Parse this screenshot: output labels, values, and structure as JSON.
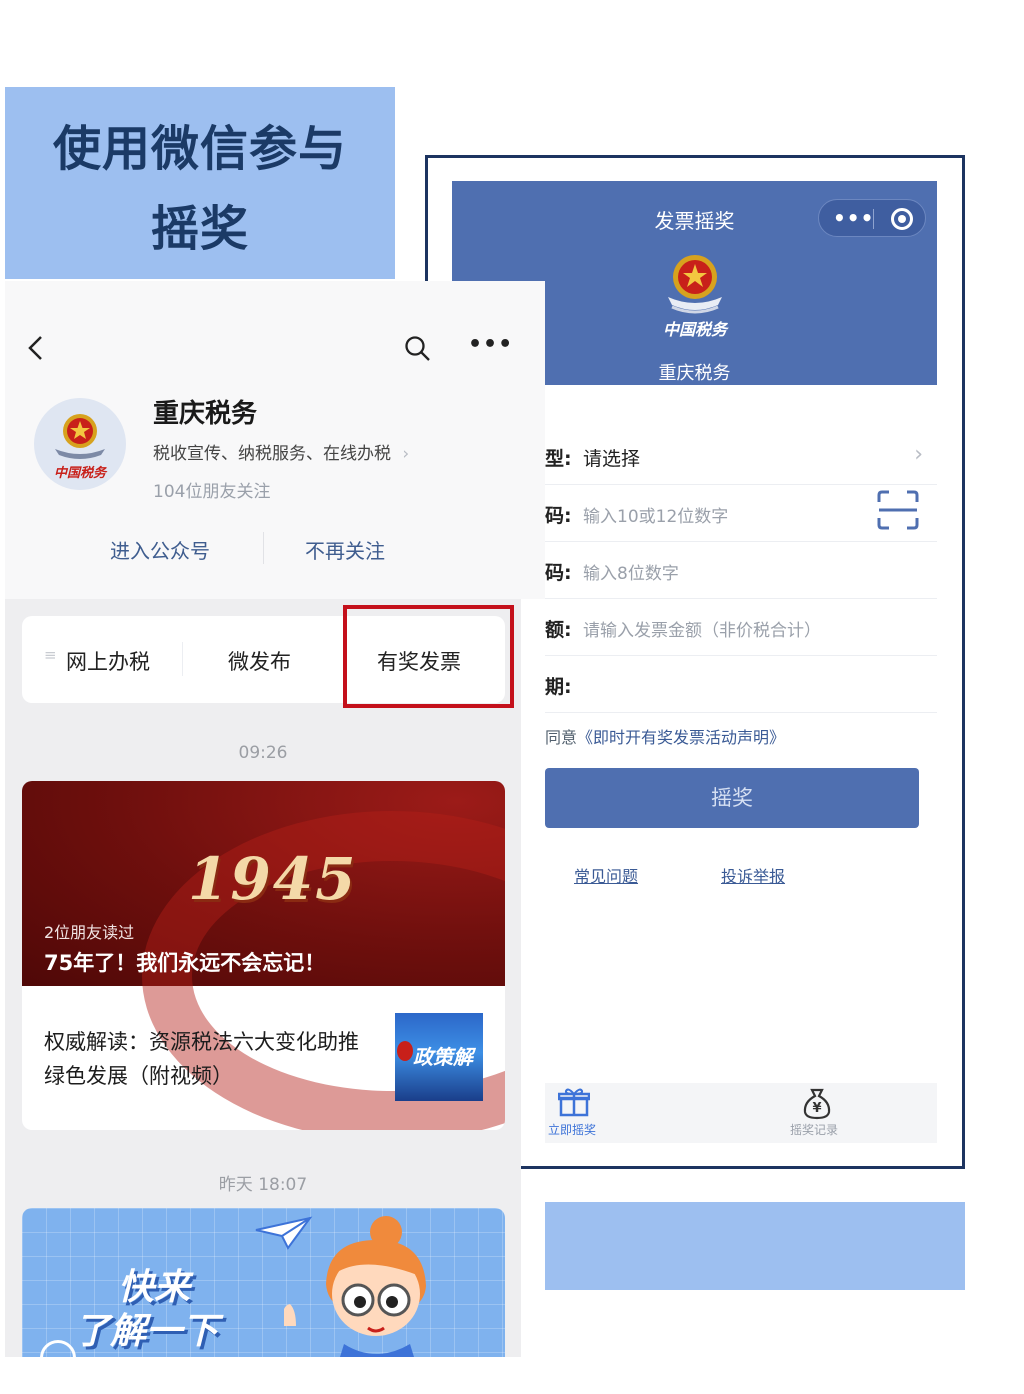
{
  "banner": {
    "line1": "使用微信参与",
    "line2": "摇奖"
  },
  "mini_program": {
    "title": "发票摇奖",
    "brand": "重庆税务",
    "form": [
      {
        "label": "型:",
        "value": "请选择",
        "placeholder": null
      },
      {
        "label": "码:",
        "value": null,
        "placeholder": "输入10或12位数字"
      },
      {
        "label": "码:",
        "value": null,
        "placeholder": "输入8位数字"
      },
      {
        "label": "额:",
        "value": null,
        "placeholder": "请输入发票金额（非价税合计）"
      },
      {
        "label": "期:",
        "value": "",
        "placeholder": null
      }
    ],
    "agreement": {
      "prefix": "同意",
      "link": "《即时开有奖发票活动声明》"
    },
    "draw_button": "摇奖",
    "links": {
      "faq": "常见问题",
      "complaint": "投诉举报"
    },
    "tabs": [
      {
        "label": "立即摇奖",
        "icon": "gift-icon"
      },
      {
        "label": "摇奖记录",
        "icon": "money-bag-icon"
      }
    ]
  },
  "account": {
    "name": "重庆税务",
    "description": "税收宣传、纳税服务、在线办税",
    "followers": "104位朋友关注",
    "enter_button": "进入公众号",
    "unfollow_button": "不再关注"
  },
  "menu": {
    "items": [
      "网上办税",
      "微发布",
      "有奖发票"
    ]
  },
  "feed": {
    "time1": "09:26",
    "cover_year": "1945",
    "cover_readers": "2位朋友读过",
    "cover_headline": "75年了！我们永远不会忘记！",
    "article2_title": "权威解读：资源税法六大变化助推绿色发展（附视频）",
    "article2_thumb_text": "政策解",
    "time2": "昨天 18:07",
    "banner_line1": "快来",
    "banner_line2": "了解一下"
  },
  "colors": {
    "header_blue": "#4f6fb0",
    "banner_blue": "#9dbff0",
    "highlight_red": "#c4101b",
    "frame_navy": "#1d3460"
  }
}
